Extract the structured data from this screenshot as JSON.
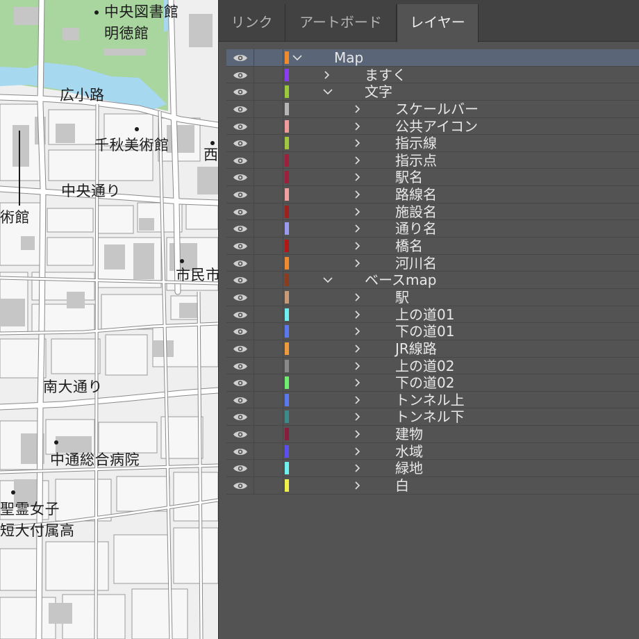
{
  "map": {
    "labels": [
      {
        "text": "中央図書館",
        "dot": true
      },
      {
        "text": "明徳館",
        "dot": false
      },
      {
        "text": "広小路",
        "dot": false
      },
      {
        "text": "千秋美術館",
        "dot": true
      },
      {
        "text": "西",
        "dot": true
      },
      {
        "text": "中央通り",
        "dot": false
      },
      {
        "text": "術館",
        "dot": false
      },
      {
        "text": "市民市",
        "dot": true
      },
      {
        "text": "南大通り",
        "dot": false
      },
      {
        "text": "中通総合病院",
        "dot": true
      },
      {
        "text": "聖霊女子",
        "dot": true
      },
      {
        "text": "短大付属高",
        "dot": false
      }
    ],
    "colors": {
      "road": "#ffffff",
      "block": "#ececec",
      "building": "#c6c6c6",
      "park": "#a9d59e",
      "water": "#a6d8f0",
      "outline": "#8a8a8a"
    }
  },
  "panel": {
    "tabs": [
      {
        "label": "リンク",
        "active": false
      },
      {
        "label": "アートボード",
        "active": false
      },
      {
        "label": "レイヤー",
        "active": true
      }
    ],
    "layers": [
      {
        "name": "Map",
        "level": 0,
        "expanded": true,
        "color": "#f08a2c",
        "selected": true
      },
      {
        "name": "ますく",
        "level": 1,
        "expanded": false,
        "color": "#8a3cf0"
      },
      {
        "name": "文字",
        "level": 1,
        "expanded": true,
        "color": "#9ac93a"
      },
      {
        "name": "スケールバー",
        "level": 2,
        "expanded": false,
        "color": "#b5b5b5"
      },
      {
        "name": "公共アイコン",
        "level": 2,
        "expanded": false,
        "color": "#f09a9a"
      },
      {
        "name": "指示線",
        "level": 2,
        "expanded": false,
        "color": "#a0c83c"
      },
      {
        "name": "指示点",
        "level": 2,
        "expanded": false,
        "color": "#a0203c"
      },
      {
        "name": "駅名",
        "level": 2,
        "expanded": false,
        "color": "#a0203c"
      },
      {
        "name": "路線名",
        "level": 2,
        "expanded": false,
        "color": "#f0a0a0"
      },
      {
        "name": "施設名",
        "level": 2,
        "expanded": false,
        "color": "#a02020"
      },
      {
        "name": "通り名",
        "level": 2,
        "expanded": false,
        "color": "#9a9af0"
      },
      {
        "name": "橋名",
        "level": 2,
        "expanded": false,
        "color": "#b01818"
      },
      {
        "name": "河川名",
        "level": 2,
        "expanded": false,
        "color": "#f08a2c"
      },
      {
        "name": "ベースmap",
        "level": 1,
        "expanded": true,
        "color": "#8a3c1c"
      },
      {
        "name": "駅",
        "level": 2,
        "expanded": false,
        "color": "#c89a78"
      },
      {
        "name": "上の道01",
        "level": 2,
        "expanded": false,
        "color": "#6ef0f0"
      },
      {
        "name": "下の道01",
        "level": 2,
        "expanded": false,
        "color": "#5a78f0"
      },
      {
        "name": "JR線路",
        "level": 2,
        "expanded": false,
        "color": "#f09a3c"
      },
      {
        "name": "上の道02",
        "level": 2,
        "expanded": false,
        "color": "#8a8a8a"
      },
      {
        "name": "下の道02",
        "level": 2,
        "expanded": false,
        "color": "#6ef06e"
      },
      {
        "name": "トンネル上",
        "level": 2,
        "expanded": false,
        "color": "#5a78f0"
      },
      {
        "name": "トンネル下",
        "level": 2,
        "expanded": false,
        "color": "#3c8a8a"
      },
      {
        "name": "建物",
        "level": 2,
        "expanded": false,
        "color": "#8a1c3c"
      },
      {
        "name": "水域",
        "level": 2,
        "expanded": false,
        "color": "#5a50f0"
      },
      {
        "name": "緑地",
        "level": 2,
        "expanded": false,
        "color": "#6ef0f0"
      },
      {
        "name": "白",
        "level": 2,
        "expanded": false,
        "color": "#f0f04a"
      }
    ],
    "icons": {
      "visibility": "eye-icon",
      "collapsed": "chevron-right-icon",
      "expanded": "chevron-down-icon"
    },
    "colors": {
      "panel_bg": "#535353",
      "tabbar_bg": "#424242",
      "selected_row": "#5a6578",
      "text": "#e8e8e8"
    }
  }
}
